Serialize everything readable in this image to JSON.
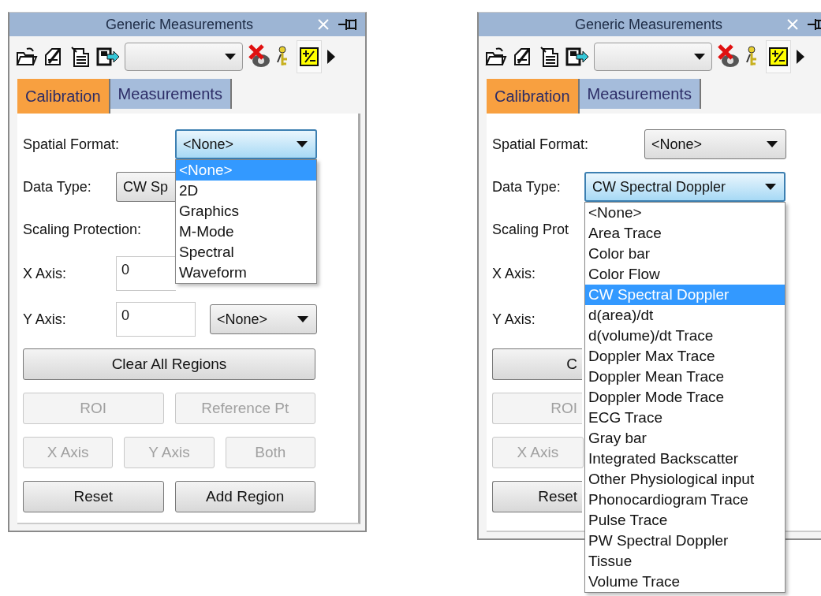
{
  "panels": [
    {
      "title": "Generic Measurements",
      "tabs": [
        {
          "label": "Calibration",
          "selected": true
        },
        {
          "label": "Measurements",
          "selected": false
        }
      ],
      "rows": [
        {
          "kind": "select",
          "label": "Spatial Format:",
          "value": "<None>",
          "focused": true,
          "options": [
            {
              "label": "<None>",
              "selected": true
            },
            {
              "label": "2D",
              "selected": false
            },
            {
              "label": "Graphics",
              "selected": false
            },
            {
              "label": "M-Mode",
              "selected": false
            },
            {
              "label": "Spectral",
              "selected": false
            },
            {
              "label": "Waveform",
              "selected": false
            }
          ]
        },
        {
          "kind": "select_cut",
          "label": "Data Type:",
          "value": "CW Sp"
        },
        {
          "kind": "label",
          "label": "Scaling Protection:"
        },
        {
          "kind": "input_cut",
          "label": "X Axis:",
          "value": "0"
        },
        {
          "kind": "input_select",
          "label": "Y Axis:",
          "value": "0",
          "select_value": "<None>"
        },
        {
          "kind": "buttons",
          "buttons": [
            {
              "label": "Clear All Regions",
              "disabled": false
            }
          ]
        },
        {
          "kind": "buttons",
          "buttons": [
            {
              "label": "ROI",
              "disabled": true
            },
            {
              "label": "Reference Pt",
              "disabled": true
            }
          ]
        },
        {
          "kind": "buttons",
          "buttons": [
            {
              "label": "X Axis",
              "disabled": true
            },
            {
              "label": "Y Axis",
              "disabled": true
            },
            {
              "label": "Both",
              "disabled": true
            }
          ]
        },
        {
          "kind": "buttons",
          "buttons": [
            {
              "label": "Reset",
              "disabled": false
            },
            {
              "label": "Add Region",
              "disabled": false
            }
          ]
        }
      ]
    },
    {
      "title": "Generic Measurements",
      "tabs": [
        {
          "label": "Calibration",
          "selected": true
        },
        {
          "label": "Measurements",
          "selected": false
        }
      ],
      "rows": [
        {
          "kind": "select",
          "label": "Spatial Format:",
          "value": "<None>",
          "focused": false
        },
        {
          "kind": "select_long",
          "label": "Data Type:",
          "value": "CW Spectral Doppler",
          "focused": true,
          "options": [
            {
              "label": "<None>",
              "selected": false
            },
            {
              "label": "Area Trace",
              "selected": false
            },
            {
              "label": "Color bar",
              "selected": false
            },
            {
              "label": "Color Flow",
              "selected": false
            },
            {
              "label": "CW Spectral Doppler",
              "selected": true
            },
            {
              "label": "d(area)/dt",
              "selected": false
            },
            {
              "label": "d(volume)/dt Trace",
              "selected": false
            },
            {
              "label": "Doppler Max Trace",
              "selected": false
            },
            {
              "label": "Doppler Mean Trace",
              "selected": false
            },
            {
              "label": "Doppler Mode Trace",
              "selected": false
            },
            {
              "label": "ECG Trace",
              "selected": false
            },
            {
              "label": "Gray bar",
              "selected": false
            },
            {
              "label": "Integrated Backscatter",
              "selected": false
            },
            {
              "label": "Other Physiological input",
              "selected": false
            },
            {
              "label": "Phonocardiogram Trace",
              "selected": false
            },
            {
              "label": "Pulse Trace",
              "selected": false
            },
            {
              "label": "PW Spectral Doppler",
              "selected": false
            },
            {
              "label": "Tissue",
              "selected": false
            },
            {
              "label": "Volume Trace",
              "selected": false
            }
          ]
        },
        {
          "kind": "label",
          "label": "Scaling Prot"
        },
        {
          "kind": "label_input",
          "label": "X Axis:"
        },
        {
          "kind": "label_input",
          "label": "Y Axis:"
        },
        {
          "kind": "partial_button",
          "label": "C",
          "disabled": false
        },
        {
          "kind": "partial_button",
          "label": "ROI",
          "disabled": true
        },
        {
          "kind": "buttons",
          "buttons": [
            {
              "label": "X Axis",
              "disabled": true
            }
          ]
        },
        {
          "kind": "partial_button",
          "label": "Reset",
          "disabled": false
        }
      ]
    }
  ]
}
